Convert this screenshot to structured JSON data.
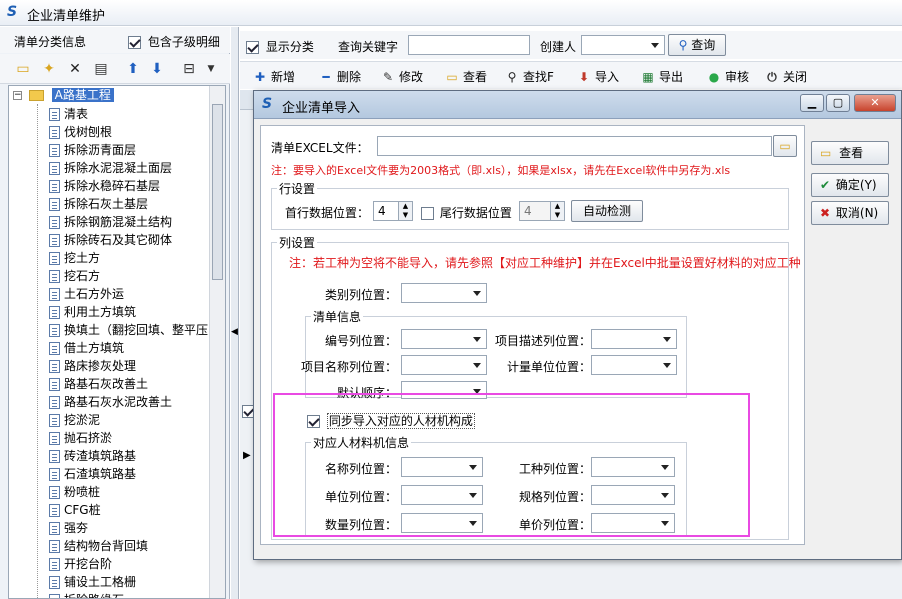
{
  "app": {
    "title": "企业清单维护",
    "logo": "S"
  },
  "left": {
    "title": "清单分类信息",
    "include_child": {
      "label": "包含子级明细",
      "checked": true
    },
    "tree_root": "A路基工程",
    "tree_items": [
      "清表",
      "伐树刨根",
      "拆除沥青面层",
      "拆除水泥混凝土面层",
      "拆除水稳碎石基层",
      "拆除石灰土基层",
      "拆除钢筋混凝土结构",
      "拆除砖石及其它砌体",
      "挖土方",
      "挖石方",
      "土石方外运",
      "利用土方填筑",
      "换填土（翻挖回填、整平压",
      "借土方填筑",
      "路床掺灰处理",
      "路基石灰改善土",
      "路基石灰水泥改善土",
      "挖淤泥",
      "抛石挤淤",
      "砖渣填筑路基",
      "石渣填筑路基",
      "粉喷桩",
      "CFG桩",
      "强夯",
      "结构物台背回填",
      "开挖台阶",
      "铺设土工格栅",
      "拆除路缘石"
    ]
  },
  "right_top": {
    "show_category": {
      "label": "显示分类",
      "checked": true
    },
    "keyword_label": "查询关键字",
    "keyword_value": "",
    "creator_label": "创建人",
    "creator_value": "",
    "query_button": "查询"
  },
  "toolbar": {
    "items": [
      {
        "label": "新增",
        "icon": "plus-icon",
        "glyph": "✚",
        "color": "#1f5fc0"
      },
      {
        "label": "删除",
        "icon": "minus-icon",
        "glyph": "━",
        "color": "#1f5fc0"
      },
      {
        "label": "修改",
        "icon": "edit-icon",
        "glyph": "✎",
        "color": "#333333"
      },
      {
        "label": "查看",
        "icon": "folder-icon",
        "glyph": "▭",
        "color": "#d9a520"
      },
      {
        "label": "查找F",
        "icon": "binoculars-icon",
        "glyph": "⚲",
        "color": "#222222"
      },
      {
        "label": "导入",
        "icon": "import-icon",
        "glyph": "⬇",
        "color": "#c0392b"
      },
      {
        "label": "导出",
        "icon": "excel-icon",
        "glyph": "▦",
        "color": "#1d7a32"
      },
      {
        "label": "审核",
        "icon": "check-icon",
        "glyph": "●",
        "color": "#2aa84a"
      },
      {
        "label": "关闭",
        "icon": "power-icon",
        "glyph": "⏻",
        "color": "#333333"
      }
    ]
  },
  "dialog": {
    "title": "企业清单导入",
    "excel_file_label": "清单EXCEL文件：",
    "excel_file_value": "",
    "note1": "注：要导入的Excel文件要为2003格式（即.xls），如果是xlsx，请先在Excel软件中另存为.xls",
    "row_settings": {
      "legend": "行设置",
      "first_row_label": "首行数据位置：",
      "first_row_value": "4",
      "tail_row_label": "尾行数据位置",
      "tail_row_checked": false,
      "tail_row_value": "4",
      "auto_detect_button": "自动检测"
    },
    "col_settings": {
      "legend": "列设置",
      "note2": "注：若工种为空将不能导入，请先参照【对应工种维护】并在Excel中批量设置好材料的对应工种",
      "category_col_label": "类别列位置：",
      "list_info": {
        "legend": "清单信息",
        "code_col_label": "编号列位置：",
        "desc_col_label": "项目描述列位置：",
        "name_col_label": "项目名称列位置：",
        "unit_col_label": "计量单位位置：",
        "default_order_label": "默认顺序："
      },
      "sync_import": {
        "label": "同步导入对应的人材机构成",
        "checked": true
      },
      "rcj_info": {
        "legend": "对应人材料机信息",
        "name_col_label": "名称列位置：",
        "worktype_col_label": "工种列位置：",
        "unit_col_label": "单位列位置：",
        "spec_col_label": "规格列位置：",
        "qty_col_label": "数量列位置：",
        "price_col_label": "单价列位置："
      }
    },
    "view_button": "查看",
    "ok_button": "确定(Y)",
    "cancel_button": "取消(N)"
  }
}
